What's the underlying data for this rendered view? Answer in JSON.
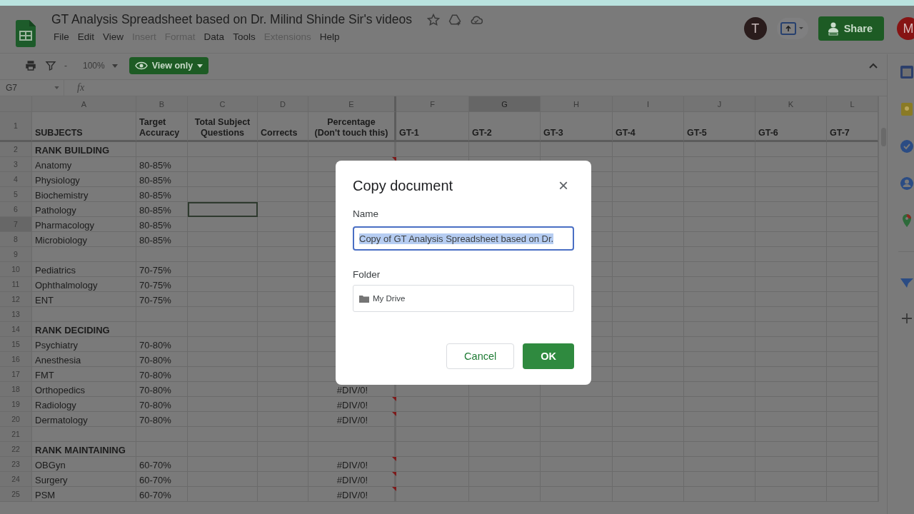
{
  "document": {
    "title": "GT Analysis Spreadsheet based on Dr. Milind Shinde Sir's videos"
  },
  "menu": [
    {
      "label": "File",
      "disabled": false
    },
    {
      "label": "Edit",
      "disabled": false
    },
    {
      "label": "View",
      "disabled": false
    },
    {
      "label": "Insert",
      "disabled": true
    },
    {
      "label": "Format",
      "disabled": true
    },
    {
      "label": "Data",
      "disabled": false
    },
    {
      "label": "Tools",
      "disabled": false
    },
    {
      "label": "Extensions",
      "disabled": true
    },
    {
      "label": "Help",
      "disabled": false
    }
  ],
  "account": {
    "collaborator_initial": "T",
    "user_initial": "M",
    "share_label": "Share"
  },
  "toolbar": {
    "filter_label": "-",
    "zoom": "100%",
    "mode_label": "View only"
  },
  "formula_bar": {
    "cell_ref": "G7",
    "formula_label": "fx"
  },
  "columns": [
    {
      "label": "A",
      "selected": false
    },
    {
      "label": "B",
      "selected": false
    },
    {
      "label": "C",
      "selected": false
    },
    {
      "label": "D",
      "selected": false
    },
    {
      "label": "E",
      "selected": false
    },
    {
      "label": "F",
      "selected": false
    },
    {
      "label": "G",
      "selected": true
    },
    {
      "label": "H",
      "selected": false
    },
    {
      "label": "I",
      "selected": false
    },
    {
      "label": "J",
      "selected": false
    },
    {
      "label": "K",
      "selected": false
    },
    {
      "label": "L",
      "selected": false
    }
  ],
  "header_row": {
    "number": "1",
    "cells": [
      "SUBJECTS",
      "Target\nAccuracy",
      "Total Subject\nQuestions",
      "Corrects",
      "Percentage\n(Don't touch this)",
      "GT-1",
      "GT-2",
      "GT-3",
      "GT-4",
      "GT-5",
      "GT-6",
      "GT-7"
    ]
  },
  "rows": [
    {
      "number": "2",
      "kind": "section",
      "subject": "RANK BUILDING",
      "selected": false,
      "c_selected": false,
      "note": false
    },
    {
      "number": "3",
      "kind": "item",
      "subject": "Anatomy",
      "target": "80-85%",
      "selected": false,
      "c_selected": false,
      "note": true
    },
    {
      "number": "4",
      "kind": "item",
      "subject": "Physiology",
      "target": "80-85%",
      "selected": false,
      "c_selected": false,
      "note": false
    },
    {
      "number": "5",
      "kind": "item",
      "subject": "Biochemistry",
      "target": "80-85%",
      "selected": false,
      "c_selected": false,
      "note": false
    },
    {
      "number": "6",
      "kind": "item",
      "subject": "Pathology",
      "target": "80-85%",
      "selected": false,
      "c_selected": true,
      "note": false
    },
    {
      "number": "7",
      "kind": "item",
      "subject": "Pharmacology",
      "target": "80-85%",
      "selected": true,
      "c_selected": false,
      "note": false
    },
    {
      "number": "8",
      "kind": "item",
      "subject": "Microbiology",
      "target": "80-85%",
      "selected": false,
      "c_selected": false,
      "note": false
    },
    {
      "number": "9",
      "kind": "blank",
      "selected": false,
      "c_selected": false,
      "note": false
    },
    {
      "number": "10",
      "kind": "item",
      "subject": "Pediatrics",
      "target": "70-75%",
      "selected": false,
      "c_selected": false,
      "note": false
    },
    {
      "number": "11",
      "kind": "item",
      "subject": "Ophthalmology",
      "target": "70-75%",
      "selected": false,
      "c_selected": false,
      "note": false
    },
    {
      "number": "12",
      "kind": "item",
      "subject": "ENT",
      "target": "70-75%",
      "selected": false,
      "c_selected": false,
      "note": false
    },
    {
      "number": "13",
      "kind": "blank",
      "selected": false,
      "c_selected": false,
      "note": false
    },
    {
      "number": "14",
      "kind": "section",
      "subject": "RANK DECIDING",
      "selected": false,
      "c_selected": false,
      "note": false
    },
    {
      "number": "15",
      "kind": "item",
      "subject": "Psychiatry",
      "target": "70-80%",
      "selected": false,
      "c_selected": false,
      "note": false
    },
    {
      "number": "16",
      "kind": "item",
      "subject": "Anesthesia",
      "target": "70-80%",
      "selected": false,
      "c_selected": false,
      "note": false
    },
    {
      "number": "17",
      "kind": "item",
      "subject": "FMT",
      "target": "70-80%",
      "selected": false,
      "c_selected": false,
      "note": false
    },
    {
      "number": "18",
      "kind": "item",
      "subject": "Orthopedics",
      "target": "70-80%",
      "percentage": "#DIV/0!",
      "selected": false,
      "c_selected": false,
      "note": false
    },
    {
      "number": "19",
      "kind": "item",
      "subject": "Radiology",
      "target": "70-80%",
      "percentage": "#DIV/0!",
      "selected": false,
      "c_selected": false,
      "note": true
    },
    {
      "number": "20",
      "kind": "item",
      "subject": "Dermatology",
      "target": "70-80%",
      "percentage": "#DIV/0!",
      "selected": false,
      "c_selected": false,
      "note": true
    },
    {
      "number": "21",
      "kind": "blank",
      "selected": false,
      "c_selected": false,
      "note": false
    },
    {
      "number": "22",
      "kind": "section",
      "subject": "RANK MAINTAINING",
      "selected": false,
      "c_selected": false,
      "note": false
    },
    {
      "number": "23",
      "kind": "item",
      "subject": "OBGyn",
      "target": "60-70%",
      "percentage": "#DIV/0!",
      "selected": false,
      "c_selected": false,
      "note": true
    },
    {
      "number": "24",
      "kind": "item",
      "subject": "Surgery",
      "target": "60-70%",
      "percentage": "#DIV/0!",
      "selected": false,
      "c_selected": false,
      "note": true
    },
    {
      "number": "25",
      "kind": "item",
      "subject": "PSM",
      "target": "60-70%",
      "percentage": "#DIV/0!",
      "selected": false,
      "c_selected": false,
      "note": true
    }
  ],
  "dialog": {
    "title": "Copy document",
    "close": "×",
    "name_label": "Name",
    "name_value": "Copy of GT Analysis Spreadsheet based on Dr.",
    "folder_label": "Folder",
    "folder": "My Drive",
    "buttons": [
      {
        "kind": "secondary",
        "label": "Cancel"
      },
      {
        "kind": "primary",
        "label": "OK"
      }
    ]
  }
}
